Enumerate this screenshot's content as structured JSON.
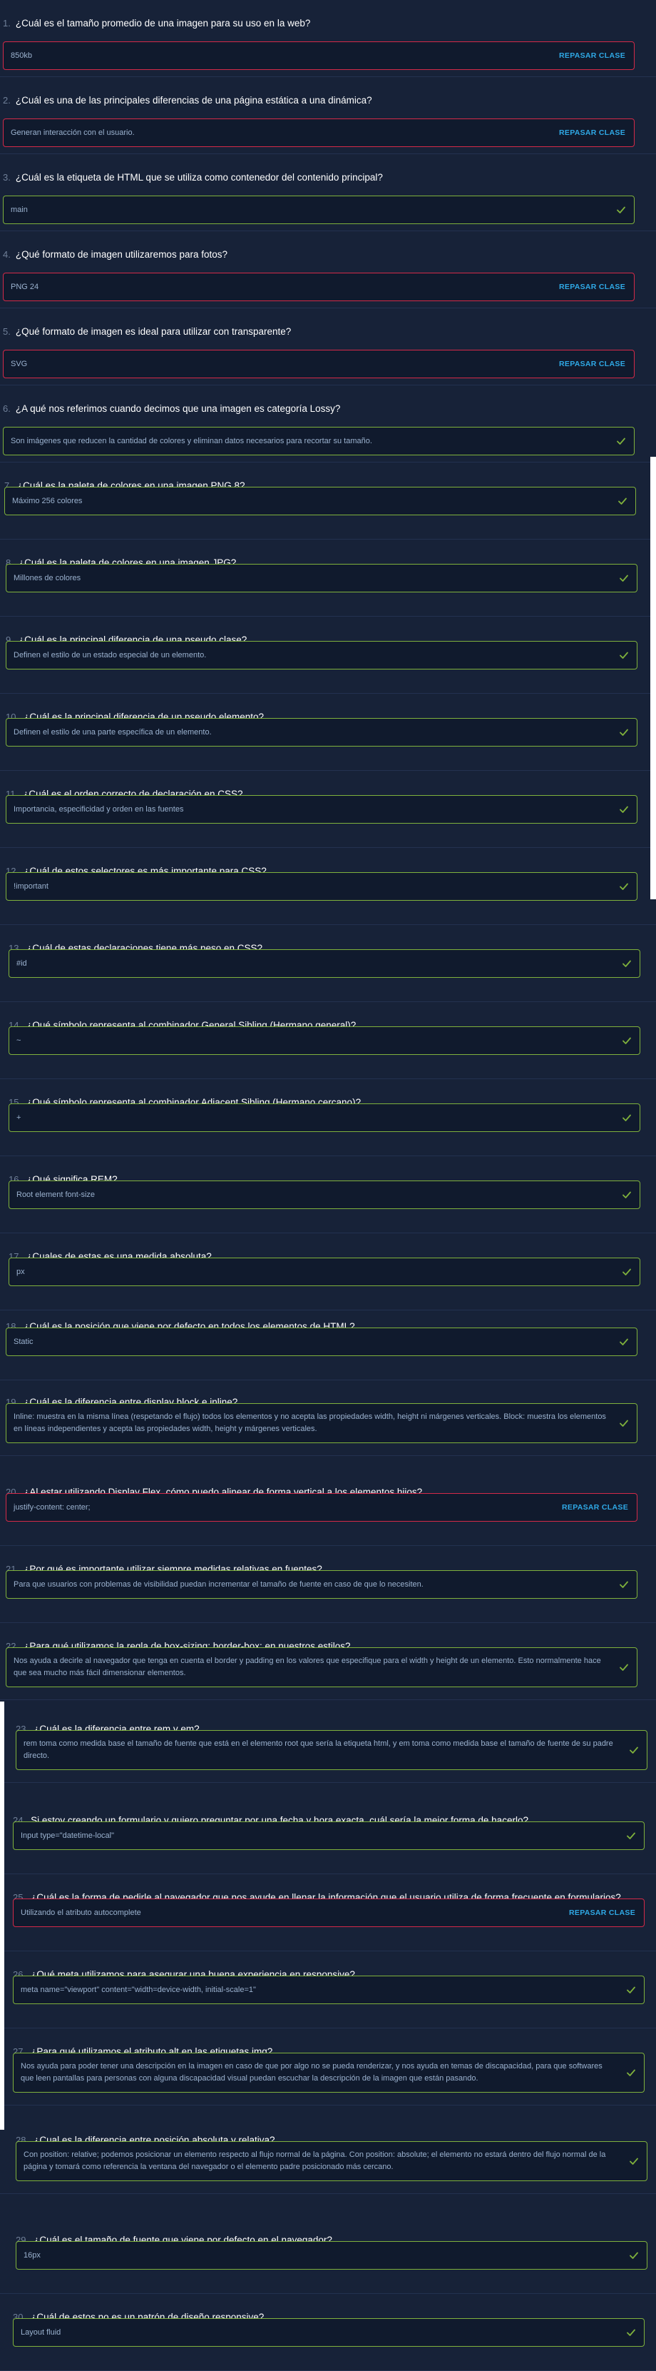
{
  "review_label": "REPASAR CLASE",
  "colors": {
    "correct": "#7fb13c",
    "incorrect": "#d42a48",
    "review_link": "#2fa9e6",
    "background": "#172238"
  },
  "icons": {
    "correct": "check-icon"
  },
  "questions": [
    {
      "num": "1.",
      "question": "¿Cuál es el tamaño promedio de una imagen para su uso en la web?",
      "answer": "850kb",
      "status": "incorrect"
    },
    {
      "num": "2.",
      "question": "¿Cuál es una de las principales diferencias de una página estática a una dinámica?",
      "answer": "Generan interacción con el usuario.",
      "status": "incorrect"
    },
    {
      "num": "3.",
      "question": "¿Cuál es la etiqueta de HTML que se utiliza como contenedor del contenido principal?",
      "answer": "main",
      "status": "correct"
    },
    {
      "num": "4.",
      "question": "¿Qué formato de imagen utilizaremos para fotos?",
      "answer": "PNG 24",
      "status": "incorrect"
    },
    {
      "num": "5.",
      "question": "¿Qué formato de imagen es ideal para utilizar con transparente?",
      "answer": "SVG",
      "status": "incorrect"
    },
    {
      "num": "6.",
      "question": "¿A qué nos referimos cuando decimos que una imagen es categoría Lossy?",
      "answer": "Son imágenes que reducen la cantidad de colores y eliminan datos necesarios para recortar su tamaño.",
      "status": "correct"
    },
    {
      "num": "7.",
      "question": "¿Cuál es la paleta de colores en una imagen PNG 8?",
      "answer": "Máximo 256 colores",
      "status": "correct"
    },
    {
      "num": "8.",
      "question": "¿Cuál es la paleta de colores en una imagen JPG?",
      "answer": "Millones de colores",
      "status": "correct"
    },
    {
      "num": "9.",
      "question": "¿Cuál es la principal diferencia de una pseudo clase?",
      "answer": "Definen el estilo de un estado especial de un elemento.",
      "status": "correct"
    },
    {
      "num": "10.",
      "question": "¿Cuál es la principal diferencia de un pseudo elemento?",
      "answer": "Definen el estilo de una parte específica de un elemento.",
      "status": "correct"
    },
    {
      "num": "11.",
      "question": "¿Cuál es el orden correcto de declaración en CSS?",
      "answer": "Importancia, especificidad y orden en las fuentes",
      "status": "correct"
    },
    {
      "num": "12.",
      "question": "¿Cuál de estos selectores es más importante para CSS?",
      "answer": "!important",
      "status": "correct"
    },
    {
      "num": "13.",
      "question": "¿Cuál de estas declaraciones tiene más peso en CSS?",
      "answer": "#id",
      "status": "correct"
    },
    {
      "num": "14.",
      "question": "¿Qué símbolo representa al combinador General Sibling (Hermano general)?",
      "answer": "~",
      "status": "correct"
    },
    {
      "num": "15.",
      "question": "¿Qué símbolo representa al combinador Adjacent Sibling (Hermano cercano)?",
      "answer": "+",
      "status": "correct"
    },
    {
      "num": "16.",
      "question": "¿Qué significa REM?",
      "answer": "Root element font-size",
      "status": "correct"
    },
    {
      "num": "17.",
      "question": "¿Cuales de estas es una medida absoluta?",
      "answer": "px",
      "status": "correct"
    },
    {
      "num": "18.",
      "question": "¿Cuál es la posición que viene por defecto en todos los elementos de HTML?",
      "answer": "Static",
      "status": "correct"
    },
    {
      "num": "19.",
      "question": "¿Cuál es la diferencia entre display block e inline?",
      "answer": "Inline: muestra en la misma línea (respetando el flujo) todos los elementos y no acepta las propiedades width, height ni márgenes verticales. Block: muestra los elementos en líneas independientes y acepta las propiedades width, height y márgenes verticales.",
      "status": "correct"
    },
    {
      "num": "20.",
      "question": "¿Al estar utilizando Display Flex, cómo puedo alinear de forma vertical a los elementos hijos?",
      "answer": "justify-content: center;",
      "status": "incorrect"
    },
    {
      "num": "21.",
      "question": "¿Por qué es importante utilizar siempre medidas relativas en fuentes?",
      "answer": "Para que usuarios con problemas de visibilidad puedan incrementar el tamaño de fuente en caso de que lo necesiten.",
      "status": "correct"
    },
    {
      "num": "22.",
      "question": "¿Para qué utilizamos la regla de box-sizing: border-box; en nuestros estilos?",
      "answer": "Nos ayuda a decirle al navegador que tenga en cuenta el border y padding en los valores que especifique para el width y height de un elemento. Esto normalmente hace que sea mucho más fácil dimensionar elementos.",
      "status": "correct"
    },
    {
      "num": "23.",
      "question": "¿Cuál es la diferencia entre rem y em?",
      "answer": "rem toma como medida base el tamaño de fuente que está en el elemento root que sería la etiqueta html, y em toma como medida base el tamaño de fuente de su padre directo.",
      "status": "correct"
    },
    {
      "num": "24.",
      "question": "Si estoy creando un formulario y quiero preguntar por una fecha y hora exacta, cuál sería la mejor forma de hacerlo?",
      "answer": "Input type=\"datetime-local\"",
      "status": "correct"
    },
    {
      "num": "25.",
      "question": "¿Cuál es la forma de pedirle al navegador que nos ayude en llenar la información que el usuario utiliza de forma frecuente en formularios?",
      "answer": "Utilizando el atributo autocomplete",
      "status": "incorrect"
    },
    {
      "num": "26.",
      "question": "¿Qué meta utilizamos para asegurar una buena experiencia en responsive?",
      "answer": "meta name=\"viewport\" content=\"width=device-width, initial-scale=1\"",
      "status": "correct"
    },
    {
      "num": "27.",
      "question": "¿Para qué utilizamos el atributo alt en las etiquetas img?",
      "answer": "Nos ayuda para poder tener una descripción en la imagen en caso de que por algo no se pueda renderizar, y nos ayuda en temas de discapacidad, para que softwares que leen pantallas para personas con alguna discapacidad visual puedan escuchar la descripción de la imagen que están pasando.",
      "status": "correct"
    },
    {
      "num": "28.",
      "question": "¿Cual es la diferencia entre posición absoluta y relativa?",
      "answer": "Con position: relative; podemos posicionar un elemento respecto al flujo normal de la página. Con position: absolute; el elemento no estará dentro del flujo normal de la página y tomará como referencia la ventana del navegador o el elemento padre posicionado más cercano.",
      "status": "correct"
    },
    {
      "num": "29.",
      "question": "¿Cuál es el tamaño de fuente que viene por defecto en el navegador?",
      "answer": "16px",
      "status": "correct"
    },
    {
      "num": "30.",
      "question": "¿Cuál de estos no es un patrón de diseño responsive?",
      "answer": "Layout fluid",
      "status": "correct"
    }
  ]
}
